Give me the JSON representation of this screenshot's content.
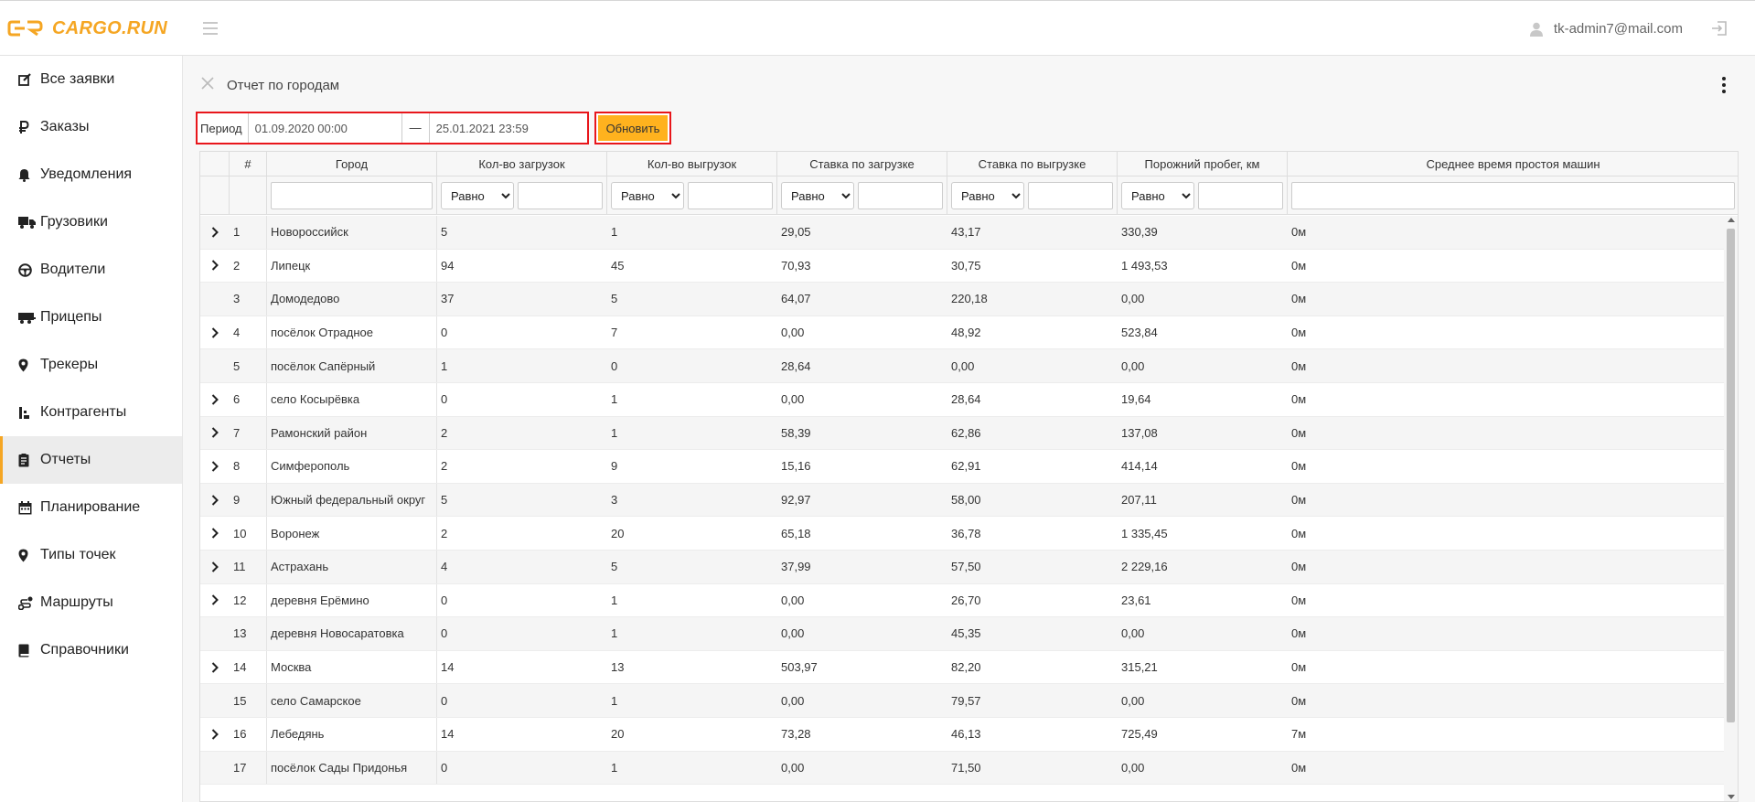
{
  "app": {
    "logo_text": "CARGO.RUN",
    "brand_color": "#f5a623",
    "highlight_color": "#e8161b",
    "button_color": "#ffb21e"
  },
  "header": {
    "user_email": "tk-admin7@mail.com"
  },
  "sidebar": {
    "items": [
      {
        "label": "Все заявки",
        "icon": "edit-icon"
      },
      {
        "label": "Заказы",
        "icon": "ruble-icon"
      },
      {
        "label": "Уведомления",
        "icon": "bell-icon"
      },
      {
        "label": "Грузовики",
        "icon": "truck-icon"
      },
      {
        "label": "Водители",
        "icon": "steering-wheel-icon"
      },
      {
        "label": "Прицепы",
        "icon": "trailer-icon"
      },
      {
        "label": "Трекеры",
        "icon": "map-pin-icon"
      },
      {
        "label": "Контрагенты",
        "icon": "contractor-icon"
      },
      {
        "label": "Отчеты",
        "icon": "report-icon",
        "active": true
      },
      {
        "label": "Планирование",
        "icon": "calendar-icon"
      },
      {
        "label": "Типы точек",
        "icon": "map-pin-icon"
      },
      {
        "label": "Маршруты",
        "icon": "route-icon"
      },
      {
        "label": "Справочники",
        "icon": "book-icon"
      }
    ]
  },
  "report": {
    "title": "Отчет по городам",
    "period_label": "Период",
    "date_from": "01.09.2020 00:00",
    "date_separator": "—",
    "date_to": "25.01.2021 23:59",
    "refresh_label": "Обновить"
  },
  "table": {
    "columns": [
      "",
      "#",
      "Город",
      "Кол-во загрузок",
      "Кол-во выгрузок",
      "Ставка по загрузке",
      "Ставка по выгрузке",
      "Порожний пробег, км",
      "Среднее время простоя машин"
    ],
    "filter_operator": "Равно",
    "rows": [
      {
        "expandable": true,
        "n": "1",
        "city": "Новороссийск",
        "loads": "5",
        "unloads": "1",
        "rate_load": "29,05",
        "rate_unload": "43,17",
        "empty_km": "330,39",
        "idle": "0м"
      },
      {
        "expandable": true,
        "n": "2",
        "city": "Липецк",
        "loads": "94",
        "unloads": "45",
        "rate_load": "70,93",
        "rate_unload": "30,75",
        "empty_km": "1 493,53",
        "idle": "0м"
      },
      {
        "expandable": false,
        "n": "3",
        "city": "Домодедово",
        "loads": "37",
        "unloads": "5",
        "rate_load": "64,07",
        "rate_unload": "220,18",
        "empty_km": "0,00",
        "idle": "0м"
      },
      {
        "expandable": true,
        "n": "4",
        "city": "посёлок Отрадное",
        "loads": "0",
        "unloads": "7",
        "rate_load": "0,00",
        "rate_unload": "48,92",
        "empty_km": "523,84",
        "idle": "0м"
      },
      {
        "expandable": false,
        "n": "5",
        "city": "посёлок Сапёрный",
        "loads": "1",
        "unloads": "0",
        "rate_load": "28,64",
        "rate_unload": "0,00",
        "empty_km": "0,00",
        "idle": "0м"
      },
      {
        "expandable": true,
        "n": "6",
        "city": "село Косырёвка",
        "loads": "0",
        "unloads": "1",
        "rate_load": "0,00",
        "rate_unload": "28,64",
        "empty_km": "19,64",
        "idle": "0м"
      },
      {
        "expandable": true,
        "n": "7",
        "city": "Рамонский район",
        "loads": "2",
        "unloads": "1",
        "rate_load": "58,39",
        "rate_unload": "62,86",
        "empty_km": "137,08",
        "idle": "0м"
      },
      {
        "expandable": true,
        "n": "8",
        "city": "Симферополь",
        "loads": "2",
        "unloads": "9",
        "rate_load": "15,16",
        "rate_unload": "62,91",
        "empty_km": "414,14",
        "idle": "0м"
      },
      {
        "expandable": true,
        "n": "9",
        "city": "Южный федеральный округ",
        "loads": "5",
        "unloads": "3",
        "rate_load": "92,97",
        "rate_unload": "58,00",
        "empty_km": "207,11",
        "idle": "0м"
      },
      {
        "expandable": true,
        "n": "10",
        "city": "Воронеж",
        "loads": "2",
        "unloads": "20",
        "rate_load": "65,18",
        "rate_unload": "36,78",
        "empty_km": "1 335,45",
        "idle": "0м"
      },
      {
        "expandable": true,
        "n": "11",
        "city": "Астрахань",
        "loads": "4",
        "unloads": "5",
        "rate_load": "37,99",
        "rate_unload": "57,50",
        "empty_km": "2 229,16",
        "idle": "0м"
      },
      {
        "expandable": true,
        "n": "12",
        "city": "деревня Ерёмино",
        "loads": "0",
        "unloads": "1",
        "rate_load": "0,00",
        "rate_unload": "26,70",
        "empty_km": "23,61",
        "idle": "0м"
      },
      {
        "expandable": false,
        "n": "13",
        "city": "деревня Новосаратовка",
        "loads": "0",
        "unloads": "1",
        "rate_load": "0,00",
        "rate_unload": "45,35",
        "empty_km": "0,00",
        "idle": "0м"
      },
      {
        "expandable": true,
        "n": "14",
        "city": "Москва",
        "loads": "14",
        "unloads": "13",
        "rate_load": "503,97",
        "rate_unload": "82,20",
        "empty_km": "315,21",
        "idle": "0м"
      },
      {
        "expandable": false,
        "n": "15",
        "city": "село Самарское",
        "loads": "0",
        "unloads": "1",
        "rate_load": "0,00",
        "rate_unload": "79,57",
        "empty_km": "0,00",
        "idle": "0м"
      },
      {
        "expandable": true,
        "n": "16",
        "city": "Лебедянь",
        "loads": "14",
        "unloads": "20",
        "rate_load": "73,28",
        "rate_unload": "46,13",
        "empty_km": "725,49",
        "idle": "7м"
      },
      {
        "expandable": false,
        "n": "17",
        "city": "посёлок Сады Придонья",
        "loads": "0",
        "unloads": "1",
        "rate_load": "0,00",
        "rate_unload": "71,50",
        "empty_km": "0,00",
        "idle": "0м"
      }
    ]
  }
}
